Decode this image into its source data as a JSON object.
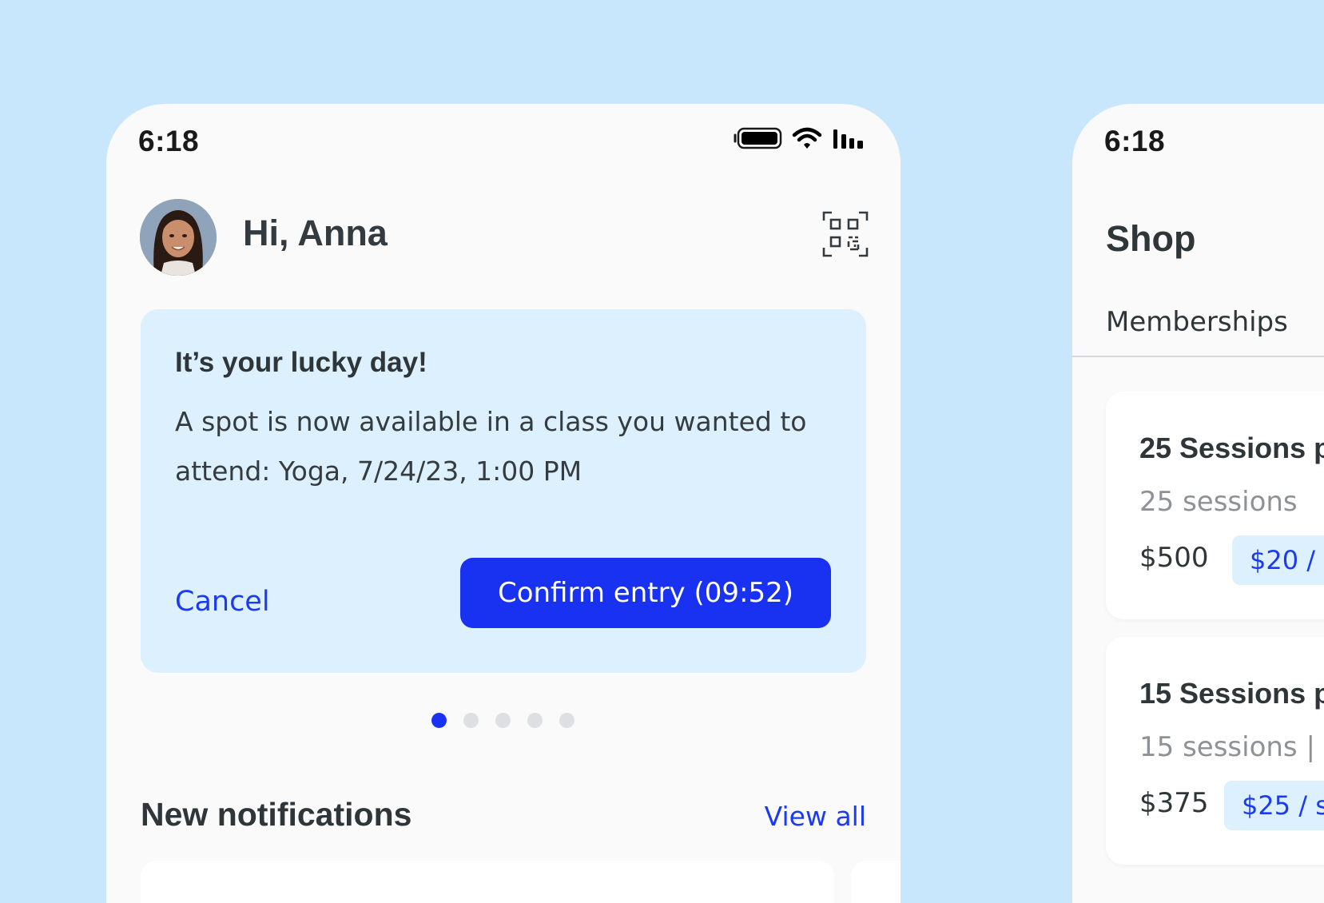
{
  "left_phone": {
    "status_bar": {
      "time": "6:18",
      "icons": [
        "battery-icon",
        "wifi-icon",
        "signal-icon"
      ]
    },
    "header": {
      "greeting": "Hi, Anna",
      "avatar": "avatar",
      "qr_icon": "qr-code-icon"
    },
    "promo": {
      "title": "It’s your lucky day!",
      "body": "A spot is now available in a class you wanted to attend: Yoga, 7/24/23, 1:00 PM",
      "cancel_label": "Cancel",
      "confirm_label": "Confirm entry (09:52)"
    },
    "pagination": {
      "count": 5,
      "active_index": 0
    },
    "notifications": {
      "title": "New notifications",
      "view_all_label": "View all"
    }
  },
  "right_phone": {
    "status_bar": {
      "time": "6:18"
    },
    "title": "Shop",
    "tab": "Memberships",
    "packages": [
      {
        "name": "25 Sessions p",
        "sessions": "25 sessions",
        "price": "$500",
        "rate": "$20 /"
      },
      {
        "name": "15 Sessions p",
        "sessions": "15 sessions  |",
        "price": "$375",
        "rate": "$25 / s"
      }
    ]
  },
  "colors": {
    "background": "#c8e6fc",
    "accent": "#1932f2",
    "link": "#1b3bf0",
    "card_tint": "#dcf0fe",
    "text_dark": "#2e3639",
    "text_muted": "#8e9296"
  }
}
